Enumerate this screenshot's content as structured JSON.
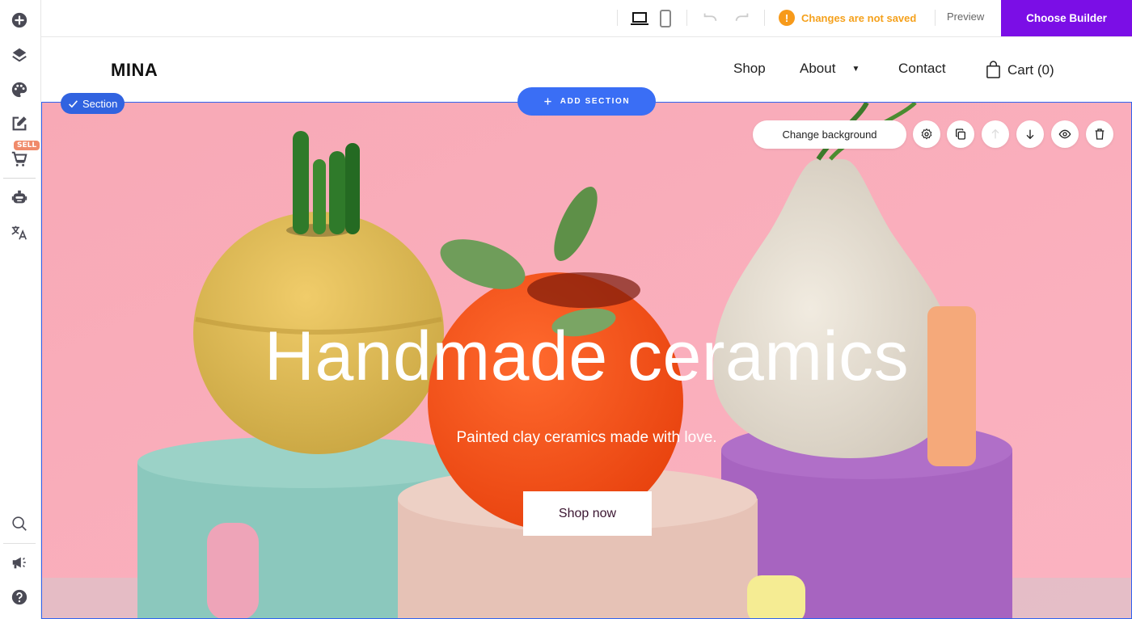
{
  "sidebar": {
    "items": [
      {
        "name": "add",
        "icon": "plus-circle-icon"
      },
      {
        "name": "layers",
        "icon": "layers-icon"
      },
      {
        "name": "design",
        "icon": "palette-icon"
      },
      {
        "name": "edit",
        "icon": "edit-icon"
      },
      {
        "name": "store",
        "icon": "cart-icon",
        "badge": "SELL"
      },
      {
        "name": "ai",
        "icon": "robot-icon"
      },
      {
        "name": "translate",
        "icon": "translate-icon"
      },
      {
        "name": "search",
        "icon": "search-icon"
      },
      {
        "name": "marketing",
        "icon": "megaphone-icon"
      },
      {
        "name": "help",
        "icon": "help-icon"
      }
    ],
    "sell_badge": "SELL"
  },
  "toolbar": {
    "status": "Changes are not saved",
    "preview_label": "Preview",
    "choose_builder_label": "Choose Builder",
    "accent": "#7b0ee6",
    "warning_color": "#f5a11c"
  },
  "site": {
    "logo": "MINA",
    "nav": {
      "shop": "Shop",
      "about": "About",
      "contact": "Contact",
      "cart": "Cart (0)"
    }
  },
  "editor": {
    "section_badge": "Section",
    "add_section": "ADD SECTION",
    "change_background": "Change background"
  },
  "hero": {
    "title": "Handmade ceramics",
    "subtitle": "Painted clay ceramics made with love.",
    "cta": "Shop now"
  }
}
